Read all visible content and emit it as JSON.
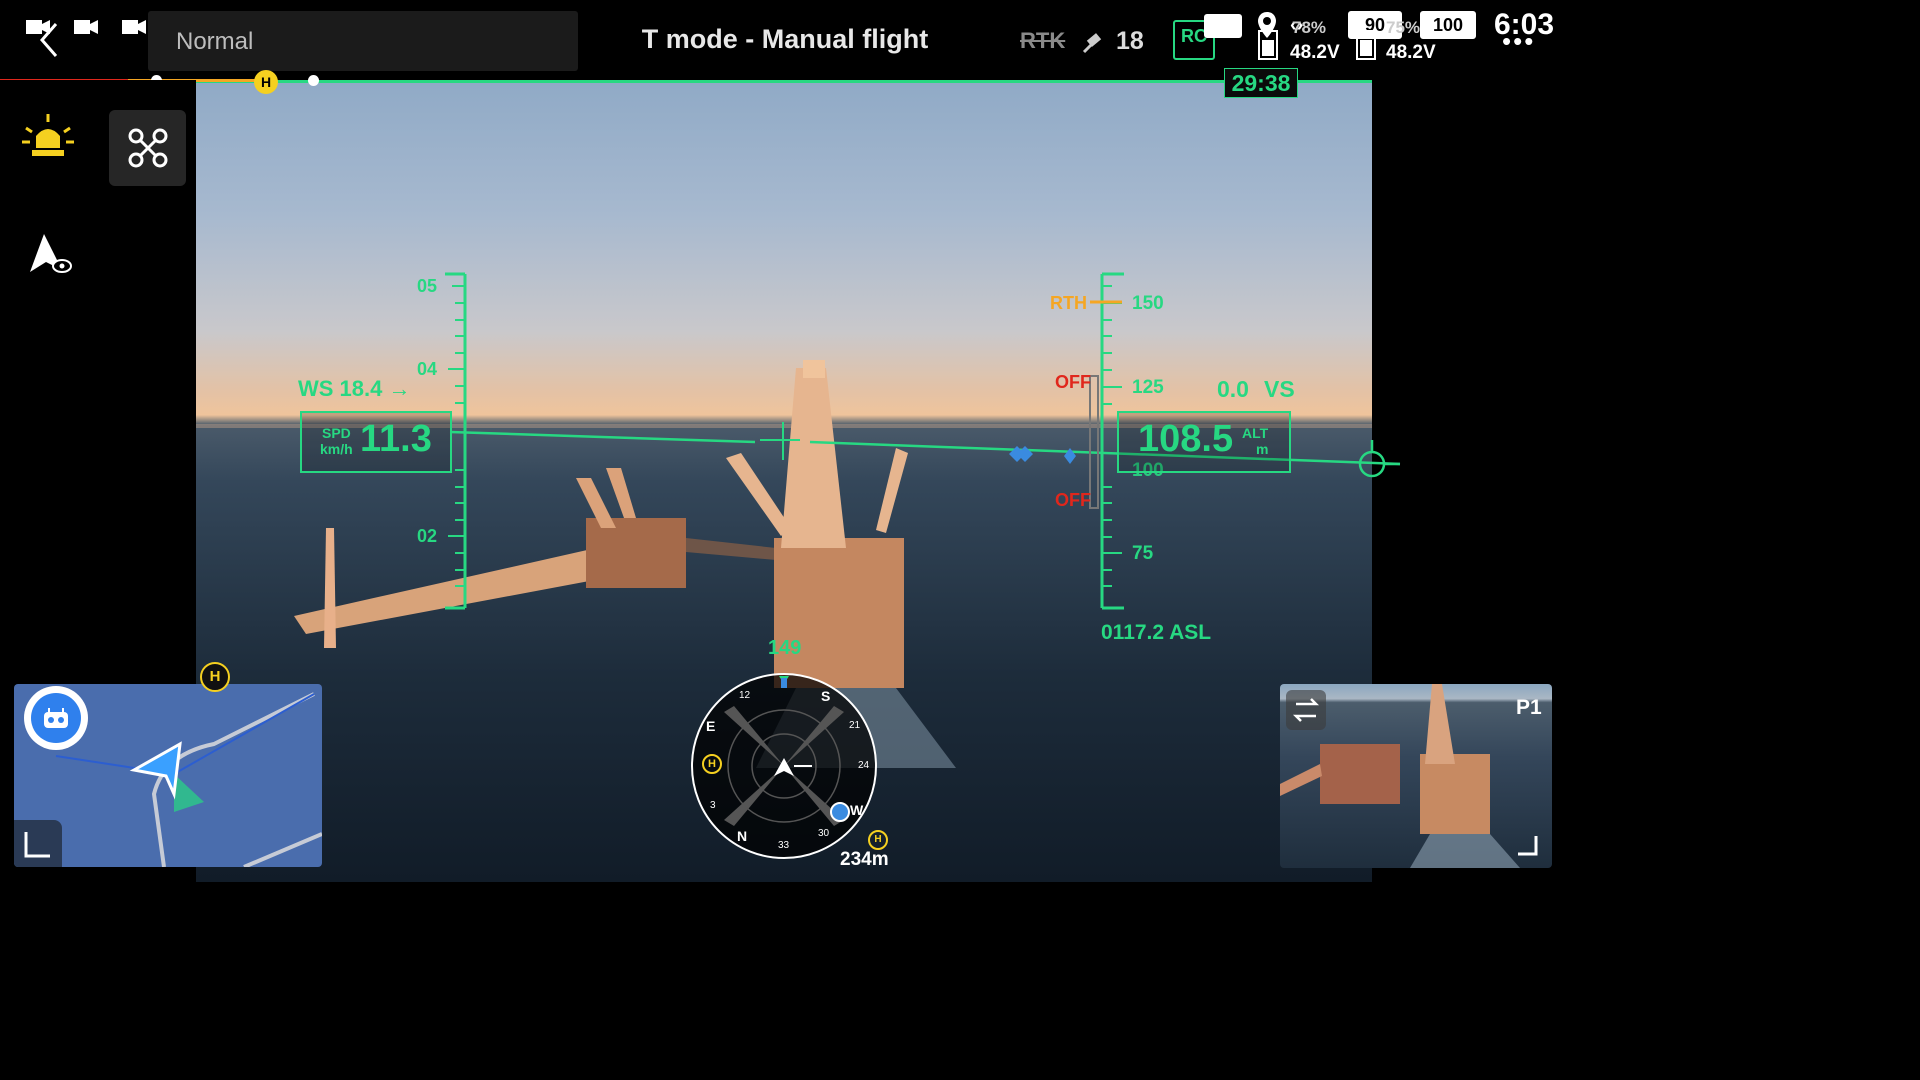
{
  "topbar": {
    "mode_select": "Normal",
    "title": "T mode - Manual flight",
    "rtk_label": "RTK",
    "satellite_count": "18",
    "rc_label": "RC",
    "battery_left_pct": "78%",
    "battery_left_voltage": "48.2V",
    "battery_right_pct": "75%",
    "battery_right_voltage": "48.2V",
    "rc_battery": "90",
    "device_battery": "100",
    "clock": "6:03",
    "flight_time_remaining": "29:38"
  },
  "hud": {
    "speed_scale_ticks": [
      "05",
      "04",
      "02"
    ],
    "wind_speed": "WS 18.4 →",
    "speed_label": "SPD",
    "speed_unit": "km/h",
    "speed_value": "11.3",
    "alt_scale_ticks": [
      "150",
      "125",
      "100",
      "75"
    ],
    "rth_label": "RTH",
    "obstacle_top": "OFF",
    "obstacle_bottom": "OFF",
    "vertical_speed": "0.0",
    "vs_label": "VS",
    "alt_label": "ALT",
    "alt_unit": "m",
    "alt_value": "108.5",
    "asl": "0117.2 ASL"
  },
  "compass": {
    "heading": "149",
    "labels": [
      "S",
      "21",
      "24",
      "W",
      "30",
      "33",
      "N",
      "3",
      "E",
      "12"
    ],
    "home_distance": "234m",
    "home_marker": "H"
  },
  "pip": {
    "label": "P1"
  },
  "colors": {
    "hud_green": "#27d882",
    "warning_yellow": "#f5d020",
    "rth_orange": "#f5a623",
    "off_red": "#e0271c"
  }
}
